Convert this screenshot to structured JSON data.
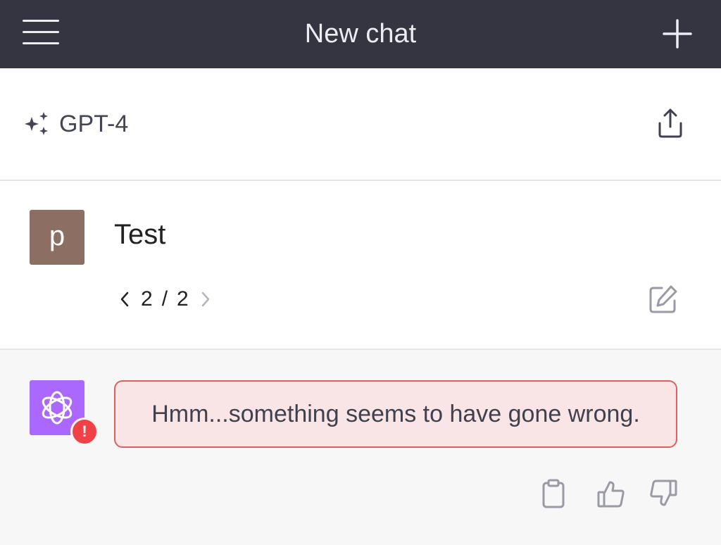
{
  "header": {
    "title": "New chat",
    "menu_icon": "hamburger-menu-icon",
    "new_chat_icon": "plus-icon",
    "background": "#343541"
  },
  "model": {
    "name": "GPT-4",
    "icon": "sparkles-icon",
    "share_icon": "share-icon"
  },
  "user_message": {
    "avatar_letter": "p",
    "avatar_color": "#8d6e63",
    "text": "Test",
    "pager": {
      "current": "2",
      "separator": "/",
      "total": "2"
    },
    "edit_icon": "edit-icon"
  },
  "assistant_message": {
    "avatar_icon": "openai-logo-icon",
    "avatar_color": "#ab68ff",
    "error_badge": "!",
    "error_text": "Hmm...something seems to have gone wrong.",
    "actions": [
      "clipboard-icon",
      "thumbs-up-icon",
      "thumbs-down-icon"
    ]
  }
}
